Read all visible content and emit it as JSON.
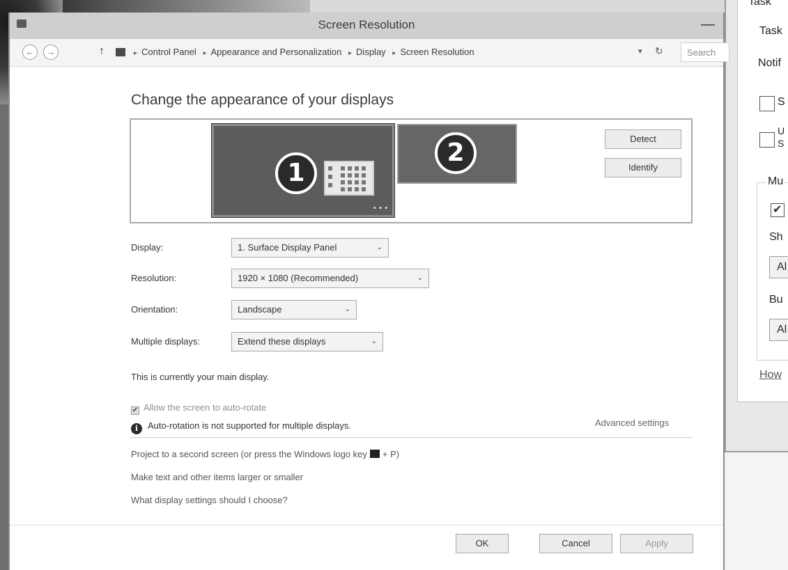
{
  "window": {
    "title": "Screen Resolution",
    "minimize_glyph": "—"
  },
  "address_bar": {
    "back_glyph": "←",
    "forward_glyph": "→",
    "up_glyph": "↑",
    "crumbs": [
      "Control Panel",
      "Appearance and Personalization",
      "Display",
      "Screen Resolution"
    ],
    "separator": "▸",
    "refresh_glyph": "↻",
    "dropdown_glyph": "▾",
    "search_placeholder": "Search"
  },
  "main": {
    "heading": "Change the appearance of your displays",
    "monitors": [
      "1",
      "2"
    ],
    "monitor_dots": "• • •",
    "detect_label": "Detect",
    "identify_label": "Identify",
    "fields": {
      "display": {
        "label": "Display:",
        "value": "1. Surface Display Panel"
      },
      "resolution": {
        "label": "Resolution:",
        "value": "1920 × 1080 (Recommended)"
      },
      "orientation": {
        "label": "Orientation:",
        "value": "Landscape"
      },
      "multiple": {
        "label": "Multiple displays:",
        "value": "Extend these displays"
      }
    },
    "main_display_text": "This is currently your main display.",
    "auto_rotate_label": "Allow the screen to auto-rotate",
    "auto_rotate_note": "Auto-rotation is not supported for multiple displays.",
    "advanced_link": "Advanced settings",
    "project_link_pre": "Project to a second screen (or press the Windows logo key",
    "project_link_post": "+ P)",
    "larger_link": "Make text and other items larger or smaller",
    "which_link": "What display settings should I choose?"
  },
  "footer": {
    "ok": "OK",
    "cancel": "Cancel",
    "apply": "Apply"
  },
  "background_window": {
    "lines": [
      "Task",
      "Task",
      "Notif",
      "S",
      "U",
      "S",
      "Mu",
      "Sh",
      "Al",
      "Bu",
      "Al",
      "How"
    ]
  }
}
